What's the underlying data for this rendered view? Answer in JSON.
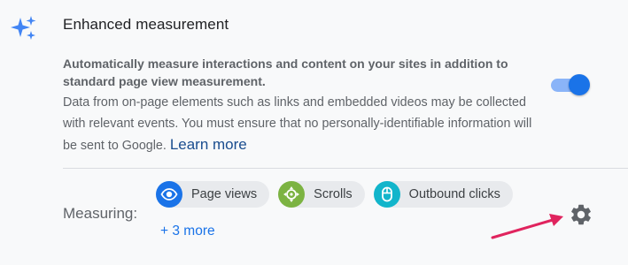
{
  "section": {
    "title": "Enhanced measurement",
    "icon": "sparkle-icon",
    "description_bold": "Automatically measure interactions and content on your sites in addition to standard page view measurement.",
    "description": "Data from on-page elements such as links and embedded videos may be collected with relevant events. You must ensure that no personally-identifiable information will be sent to Google.",
    "learn_more": "Learn more",
    "toggle_on": true
  },
  "measuring": {
    "label": "Measuring:",
    "chips": [
      {
        "label": "Page views",
        "icon": "eye-icon",
        "color": "#1a73e8"
      },
      {
        "label": "Scrolls",
        "icon": "crosshair-icon",
        "color": "#7cb342"
      },
      {
        "label": "Outbound clicks",
        "icon": "mouse-icon",
        "color": "#12b5cb"
      }
    ],
    "more": "+ 3 more",
    "settings_icon": "gear-icon"
  },
  "colors": {
    "accent": "#1a73e8",
    "annotation_arrow": "#e0245e"
  }
}
